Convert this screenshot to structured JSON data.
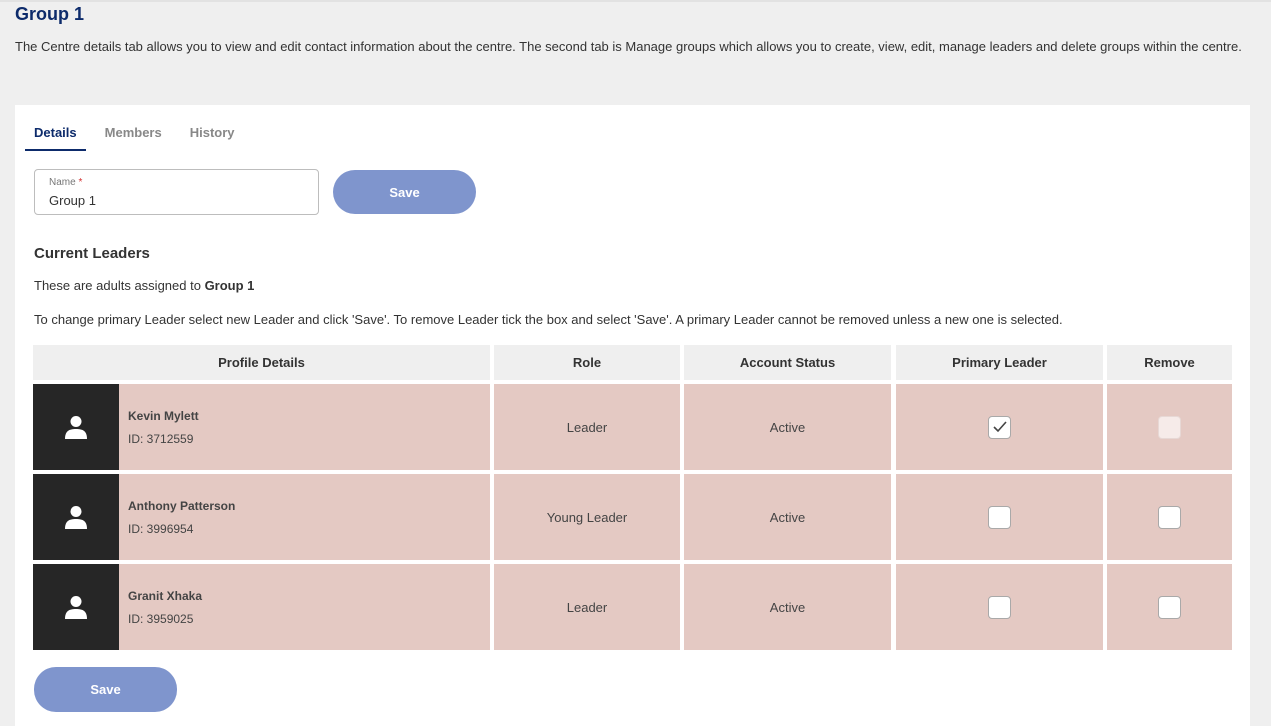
{
  "page": {
    "title": "Group 1",
    "intro": "The Centre details tab allows you to view and edit contact information about the centre. The second tab is Manage groups which allows you to create, view, edit, manage leaders and delete groups within the centre."
  },
  "tabs": [
    {
      "label": "Details",
      "active": true
    },
    {
      "label": "Members",
      "active": false
    },
    {
      "label": "History",
      "active": false
    }
  ],
  "form": {
    "name_label": "Name",
    "required_mark": "*",
    "name_value": "Group 1",
    "save_label": "Save"
  },
  "leaders": {
    "section_title": "Current Leaders",
    "assigned_prefix": "These are adults assigned to",
    "assigned_group": "Group 1",
    "instructions": "To change primary Leader select new Leader and click 'Save'. To remove Leader tick the box and select 'Save'. A primary Leader cannot be removed unless a new one is selected.",
    "columns": [
      "Profile Details",
      "Role",
      "Account Status",
      "Primary Leader",
      "Remove"
    ],
    "rows": [
      {
        "name": "Kevin Mylett",
        "id": "ID: 3712559",
        "role": "Leader",
        "status": "Active",
        "primary": true,
        "remove_disabled": true
      },
      {
        "name": "Anthony Patterson",
        "id": "ID: 3996954",
        "role": "Young Leader",
        "status": "Active",
        "primary": false,
        "remove_disabled": false
      },
      {
        "name": "Granit Xhaka",
        "id": "ID: 3959025",
        "role": "Leader",
        "status": "Active",
        "primary": false,
        "remove_disabled": false
      }
    ]
  },
  "footer": {
    "save_label": "Save"
  },
  "colors": {
    "accent": "#0d2b6b",
    "button": "#7f95cd",
    "row_bg": "#e4c9c3",
    "avatar_bg": "#262626"
  }
}
